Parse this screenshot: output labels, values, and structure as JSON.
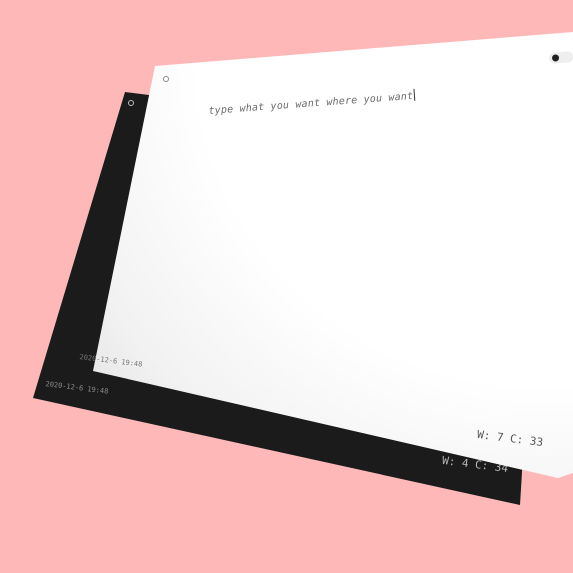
{
  "colors": {
    "background": "#ffb8b8",
    "dark_sheet": "#1b1b1b",
    "light_sheet": "#ffffff"
  },
  "dark_page": {
    "settings_icon": "gear-icon",
    "date": "2020-12-6 19:48",
    "word_count": "W: 4",
    "char_count": "C: 34"
  },
  "light_page": {
    "settings_icon": "gear-icon",
    "theme_toggle_icon": "toggle-icon",
    "editor_text": "type what you want where you want",
    "date": "2020-12-6 19:48",
    "word_count": "W: 7",
    "char_count": "C: 33"
  }
}
